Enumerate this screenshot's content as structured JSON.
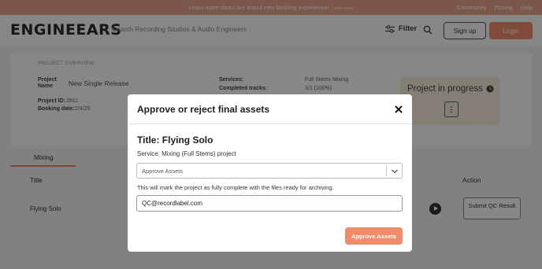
{
  "promo": {
    "message": "Learn more about our brand new booking experience!",
    "learn_more": "Learn more",
    "links": [
      "Community",
      "Pricing",
      "Help"
    ]
  },
  "header": {
    "logo": "ENGINEEARS",
    "search_placeholder": "Search Recording Studios & Audio Engineers",
    "filter": "Filter",
    "signup": "Sign up",
    "login": "Login"
  },
  "overview": {
    "section_title": "PROJECT OVERVIEW",
    "project_name_label": "Project Name",
    "project_name": "New Single Release",
    "project_id_label": "Project ID:",
    "project_id": "2811",
    "booking_date_label": "Booking date:",
    "booking_date": "2/4/25",
    "services_label": "Services:",
    "services": "Full Stems Mixing",
    "completed_tracks_label": "Completed tracks:",
    "completed_tracks": "1/1 (100%)",
    "status": "Project in progress",
    "more_icon": "vertical-dots-icon",
    "status_icon": "clock-icon"
  },
  "tabs": [
    "Mixing"
  ],
  "table": {
    "headers": [
      "Title",
      "Action"
    ],
    "rows": [
      {
        "title": "Flying Solo",
        "action": "Submit QC Result"
      }
    ]
  },
  "modal": {
    "title": "Approve or reject final assets",
    "subtitle": "Title: Flying Solo",
    "service": "Service: Mixing (Full Stems) project",
    "select_value": "Approve Assets",
    "note": "This will mark the project as fully complete with the files ready for archiving.",
    "email_value": "QC@recordlabel.com",
    "confirm": "Approve Assets",
    "close_icon": "close-icon"
  },
  "colors": {
    "accent": "#f08c69",
    "promo_bg": "#e8a58a",
    "status_bg": "#fbeee0"
  }
}
